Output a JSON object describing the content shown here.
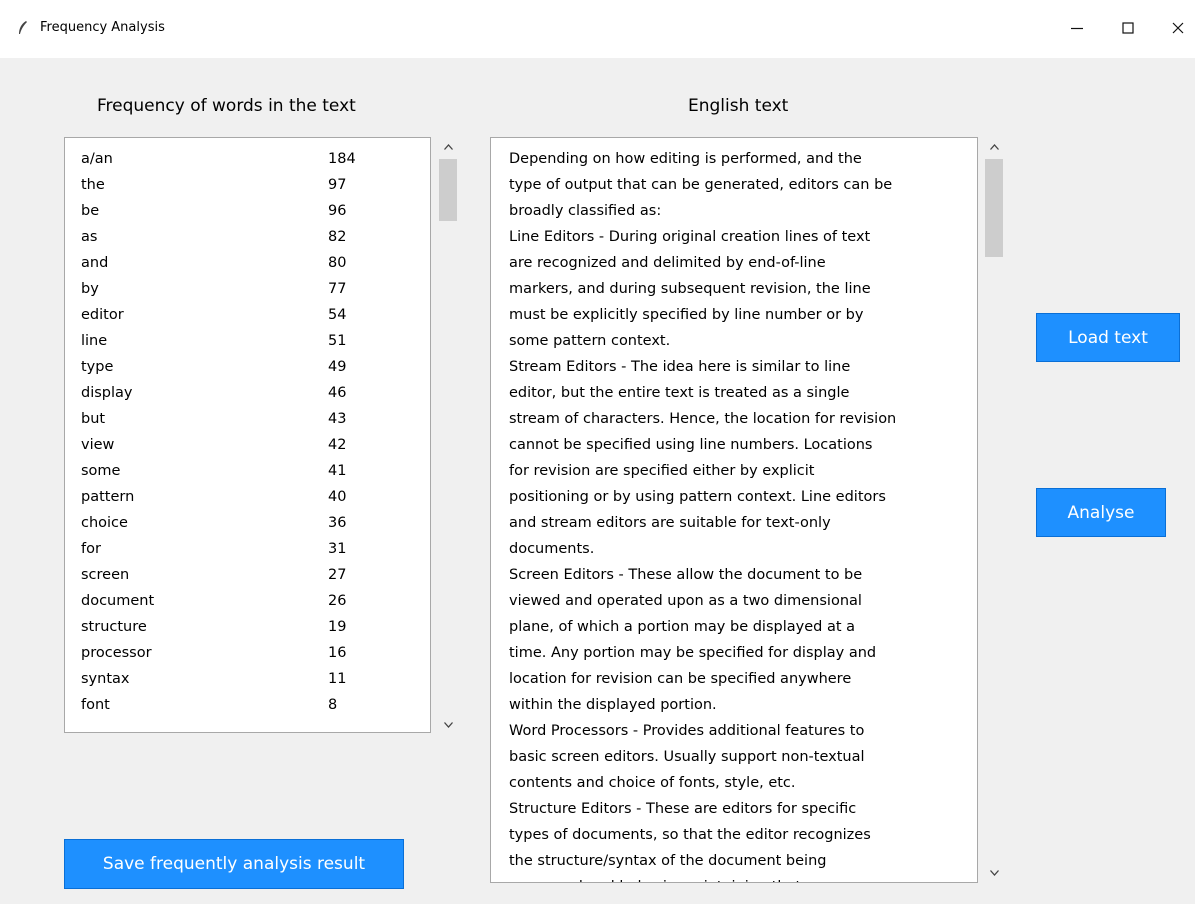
{
  "window": {
    "title": "Frequency Analysis",
    "controls": {
      "minimize": "–",
      "maximize": "☐",
      "close": "✕"
    }
  },
  "labels": {
    "frequency_heading": "Frequency of words in the text",
    "english_heading": "English text"
  },
  "frequency_list": [
    {
      "word": "a/an",
      "count": "184"
    },
    {
      "word": "the",
      "count": "97"
    },
    {
      "word": "be",
      "count": "96"
    },
    {
      "word": "as",
      "count": "82"
    },
    {
      "word": "and",
      "count": "80"
    },
    {
      "word": "by",
      "count": "77"
    },
    {
      "word": "editor",
      "count": "54"
    },
    {
      "word": "line",
      "count": "51"
    },
    {
      "word": "type",
      "count": "49"
    },
    {
      "word": "display",
      "count": "46"
    },
    {
      "word": "but",
      "count": "43"
    },
    {
      "word": "view",
      "count": "42"
    },
    {
      "word": "some",
      "count": "41"
    },
    {
      "word": "pattern",
      "count": "40"
    },
    {
      "word": "choice",
      "count": "36"
    },
    {
      "word": "for",
      "count": "31"
    },
    {
      "word": "screen",
      "count": "27"
    },
    {
      "word": "document",
      "count": "26"
    },
    {
      "word": "structure",
      "count": "19"
    },
    {
      "word": "processor",
      "count": "16"
    },
    {
      "word": "syntax",
      "count": "11"
    },
    {
      "word": "font",
      "count": "8"
    }
  ],
  "english_text": [
    "Depending on how editing  is performed, and the",
    "type of output that can be generated, editors can be",
    "broadly classified  as:",
    "Line Editors - During original creation lines of text",
    "are recognized and delimited  by end-of-line",
    "markers, and during subsequent revision, the line",
    "must be explicitly  specified  by line number or by",
    "some pattern  context.",
    "Stream  Editors - The idea here is similar to line",
    "editor, but the entire text is treated  as a single",
    "stream of characters. Hence, the location for revision",
    "cannot be specified  using line numbers. Locations",
    "for revision are specified  either by explicit",
    "positioning  or by using pattern context.  Line editors",
    "and stream editors are suitable  for text-only",
    "documents.",
    "Screen Editors - These allow the document to be",
    "viewed and operated upon as a two  dimensional",
    "plane, of which a portion may be displayed at a",
    "time. Any portion may be specified  for display  and",
    "location  for revision  can be specified  anywhere",
    "within the displayed portion.",
    "Word Processors - Provides additional features  to",
    "basic screen editors.  Usually support non-textual",
    "contents and choice of fonts,  style,  etc.",
    "Structure Editors - These are editors for specific",
    "types of documents, so that the editor recognizes",
    "the structure/syntax of the document being",
    "processed and helps in maintaining  that"
  ],
  "buttons": {
    "load": "Load text",
    "analyse": "Analyse",
    "save": "Save frequently analysis result"
  },
  "colors": {
    "button_bg": "#1e90ff",
    "button_text": "#ffffff"
  }
}
